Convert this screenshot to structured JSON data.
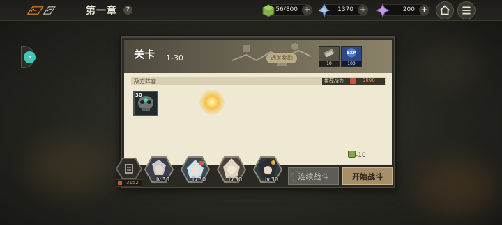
{
  "header": {
    "chapter_title": "第一章",
    "help_glyph": "?",
    "back_icon": "back-logo-icon",
    "resources": [
      {
        "name": "stamina",
        "icon": "stamina-cube-icon",
        "value": "56/800",
        "plus": "+"
      },
      {
        "name": "crystal",
        "icon": "blue-crystal-icon",
        "value": "1370",
        "plus": "+"
      },
      {
        "name": "gem",
        "icon": "purple-gem-icon",
        "value": "200",
        "plus": "+"
      }
    ],
    "home_icon": "home-icon",
    "menu_icon": "menu-icon"
  },
  "side_tab": {
    "arrow": "›"
  },
  "stage": {
    "title": "关卡",
    "number": "1-30",
    "reward_label": "通关奖励",
    "rewards": [
      {
        "icon": "material-item-icon",
        "count": "10"
      },
      {
        "icon": "exp-icon",
        "label": "EXP",
        "count": "100"
      }
    ]
  },
  "enemy": {
    "section_label": "敌方阵容",
    "power_label": "推荐战力",
    "power_value": "2890",
    "units": [
      {
        "level": "30",
        "icon": "skull-enemy-icon"
      }
    ]
  },
  "cost": {
    "icon": "stamina-cube-icon",
    "value": "-10"
  },
  "team": {
    "lineup_icon": "lineup-icon",
    "power_value": "3152",
    "heroes": [
      {
        "level": "lv.30",
        "icon": "hero-icon"
      },
      {
        "level": "lv.30",
        "icon": "hero-icon"
      },
      {
        "level": "lv.30",
        "icon": "hero-icon"
      },
      {
        "level": "lv.30",
        "icon": "hero-icon"
      }
    ]
  },
  "buttons": {
    "auto_battle": "连续战斗",
    "start_battle": "开始战斗"
  },
  "colors": {
    "accent_teal": "#3fc7b6",
    "start_button": "#a68f66",
    "panel_bg": "#efe8d3",
    "power_red": "#c7573a"
  }
}
